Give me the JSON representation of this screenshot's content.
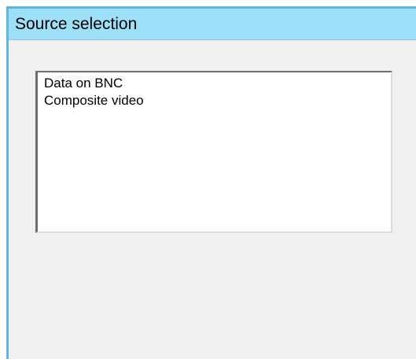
{
  "window": {
    "title": "Source selection"
  },
  "source_list": {
    "items": [
      {
        "label": "Data on BNC"
      },
      {
        "label": "Composite video"
      }
    ]
  },
  "colors": {
    "titlebar_background": "#9ddff7",
    "window_border": "#5fb5e5",
    "panel_background": "#f0f0f0",
    "listbox_background": "#ffffff"
  }
}
